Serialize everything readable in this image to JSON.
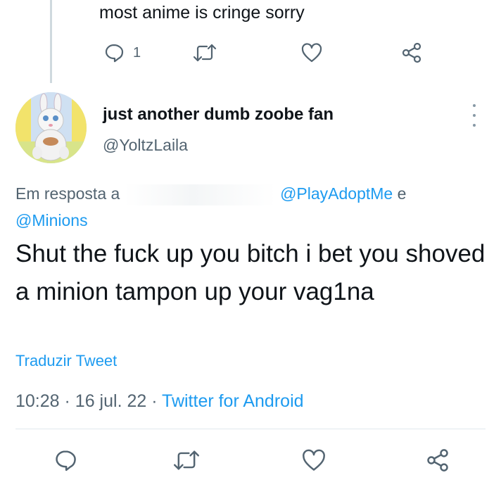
{
  "previous_tweet": {
    "text": "most anime is cringe sorry",
    "reply_count": "1",
    "icons": [
      "reply-icon",
      "retweet-icon",
      "like-icon",
      "share-icon"
    ]
  },
  "tweet": {
    "author_name": "just another dumb zoobe fan",
    "author_handle": "@YoltzLaila",
    "reply_prefix": "Em resposta a",
    "mention_1": "@PlayAdoptMe",
    "conjunction": "e",
    "mention_2": "@Minions",
    "text": "Shut the fuck up you bitch i bet you shoved a minion tampon up your vag1na",
    "translate_label": "Traduzir Tweet",
    "time": "10:28",
    "date": "16 jul. 22",
    "source": "Twitter for Android",
    "separator": "·"
  },
  "colors": {
    "link": "#1d9bf0",
    "secondary_text": "#536471",
    "primary_text": "#0f1419",
    "thread_line": "#cfd9de"
  }
}
